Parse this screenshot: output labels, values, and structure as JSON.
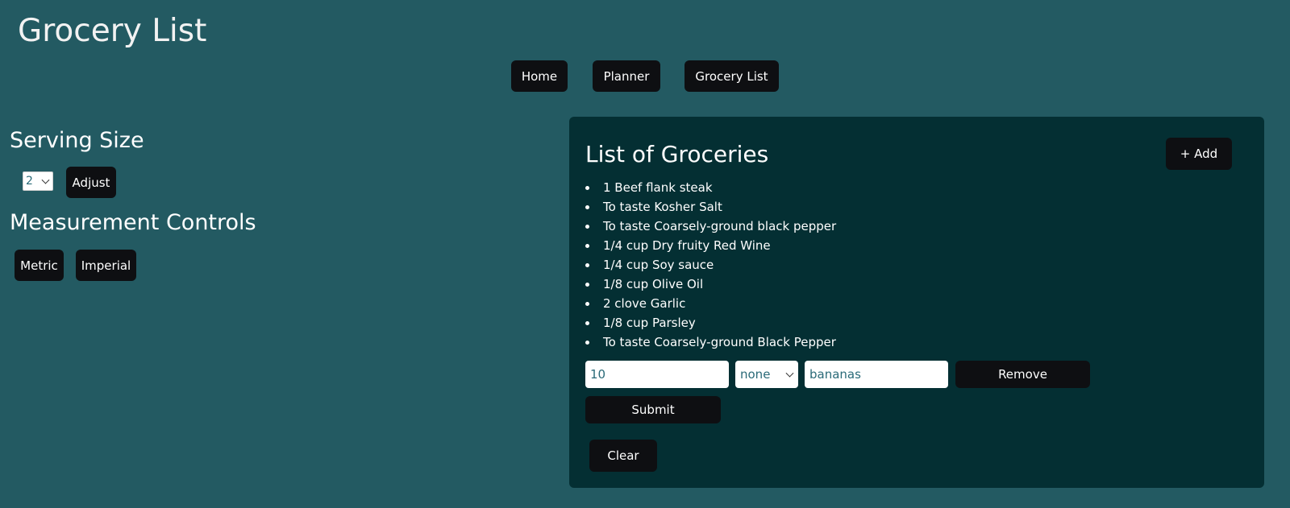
{
  "header": {
    "title": "Grocery List"
  },
  "nav": {
    "home": "Home",
    "planner": "Planner",
    "grocery_list": "Grocery List"
  },
  "sidebar": {
    "serving_size_heading": "Serving Size",
    "serving_size_value": "2",
    "adjust_label": "Adjust",
    "measurement_heading": "Measurement Controls",
    "metric_label": "Metric",
    "imperial_label": "Imperial"
  },
  "groceries": {
    "heading": "List of Groceries",
    "add_label": "+ Add",
    "items": [
      "1 Beef flank steak",
      "To taste Kosher Salt",
      "To taste Coarsely-ground black pepper",
      "1/4 cup Dry fruity Red Wine",
      "1/4 cup Soy sauce",
      "1/8 cup Olive Oil",
      "2 clove Garlic",
      "1/8 cup Parsley",
      "To taste Coarsely-ground Black Pepper"
    ],
    "form": {
      "quantity_value": "10",
      "unit_value": "none",
      "name_value": "bananas",
      "remove_label": "Remove",
      "submit_label": "Submit"
    },
    "clear_label": "Clear"
  },
  "colors": {
    "background": "#235a62",
    "panel": "#042f33",
    "button": "#0e0f12",
    "input_text": "#2a6a78"
  }
}
